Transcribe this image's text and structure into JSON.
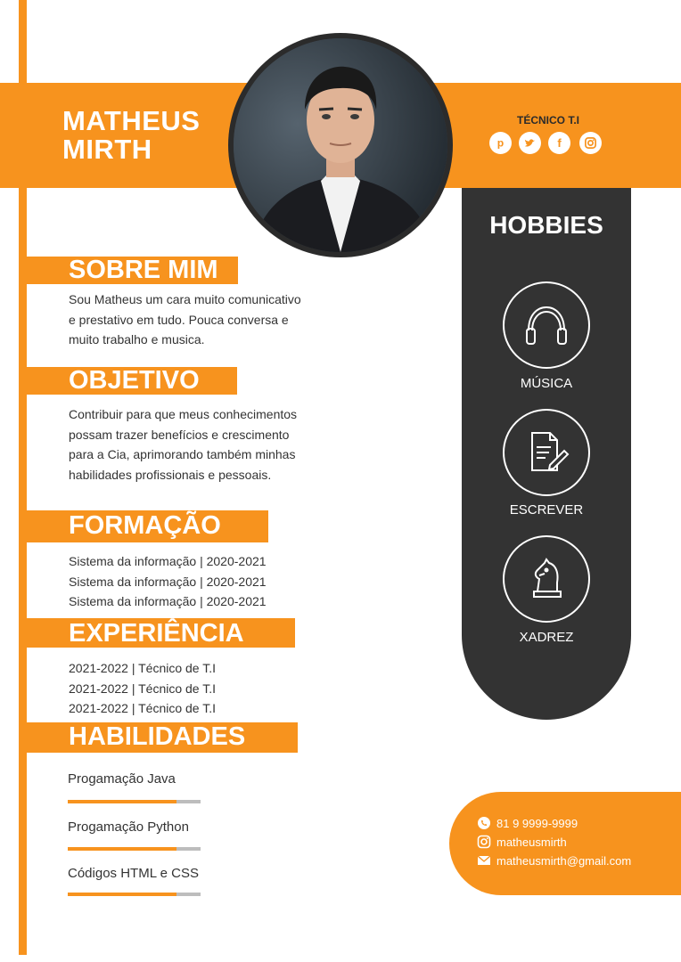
{
  "colors": {
    "accent": "#f7931e",
    "dark": "#333333",
    "text": "#333333",
    "white": "#ffffff"
  },
  "header": {
    "name_line1": "MATHEUS",
    "name_line2": "MIRTH",
    "role": "TÉCNICO T.I",
    "social_icons": [
      "pinterest-icon",
      "twitter-icon",
      "facebook-icon",
      "instagram-icon"
    ]
  },
  "about": {
    "title": "SOBRE MIM",
    "lines": [
      "Sou Matheus um cara muito comunicativo",
      "e prestativo em tudo. Pouca conversa e",
      "muito trabalho e musica."
    ]
  },
  "objective": {
    "title": "OBJETIVO",
    "lines": [
      "Contribuir para que meus conhecimentos",
      "possam trazer benefícios e crescimento",
      "para a Cia, aprimorando também minhas",
      "habilidades profissionais e pessoais."
    ]
  },
  "education": {
    "title": "FORMAÇÃO",
    "items": [
      "Sistema da informação | 2020-2021",
      "Sistema da informação | 2020-2021",
      "Sistema da informação | 2020-2021"
    ]
  },
  "experience": {
    "title": "EXPERIÊNCIA",
    "items": [
      "2021-2022 | Técnico de T.I",
      "2021-2022 | Técnico de T.I",
      "2021-2022 | Técnico de T.I"
    ]
  },
  "skills": {
    "title": "HABILIDADES",
    "items": [
      {
        "name": "Progamação Java",
        "level": 0.82
      },
      {
        "name": "Progamação Python",
        "level": 0.82
      },
      {
        "name": "Códigos HTML e CSS",
        "level": 0.82
      }
    ]
  },
  "hobbies": {
    "title": "HOBBIES",
    "items": [
      {
        "label": "MÚSICA",
        "icon": "headphones-icon"
      },
      {
        "label": "ESCREVER",
        "icon": "document-pen-icon"
      },
      {
        "label": "XADREZ",
        "icon": "chess-knight-icon"
      }
    ]
  },
  "contact": {
    "phone": "81 9 9999-9999",
    "instagram": "matheusmirth",
    "email": "matheusmirth@gmail.com"
  }
}
